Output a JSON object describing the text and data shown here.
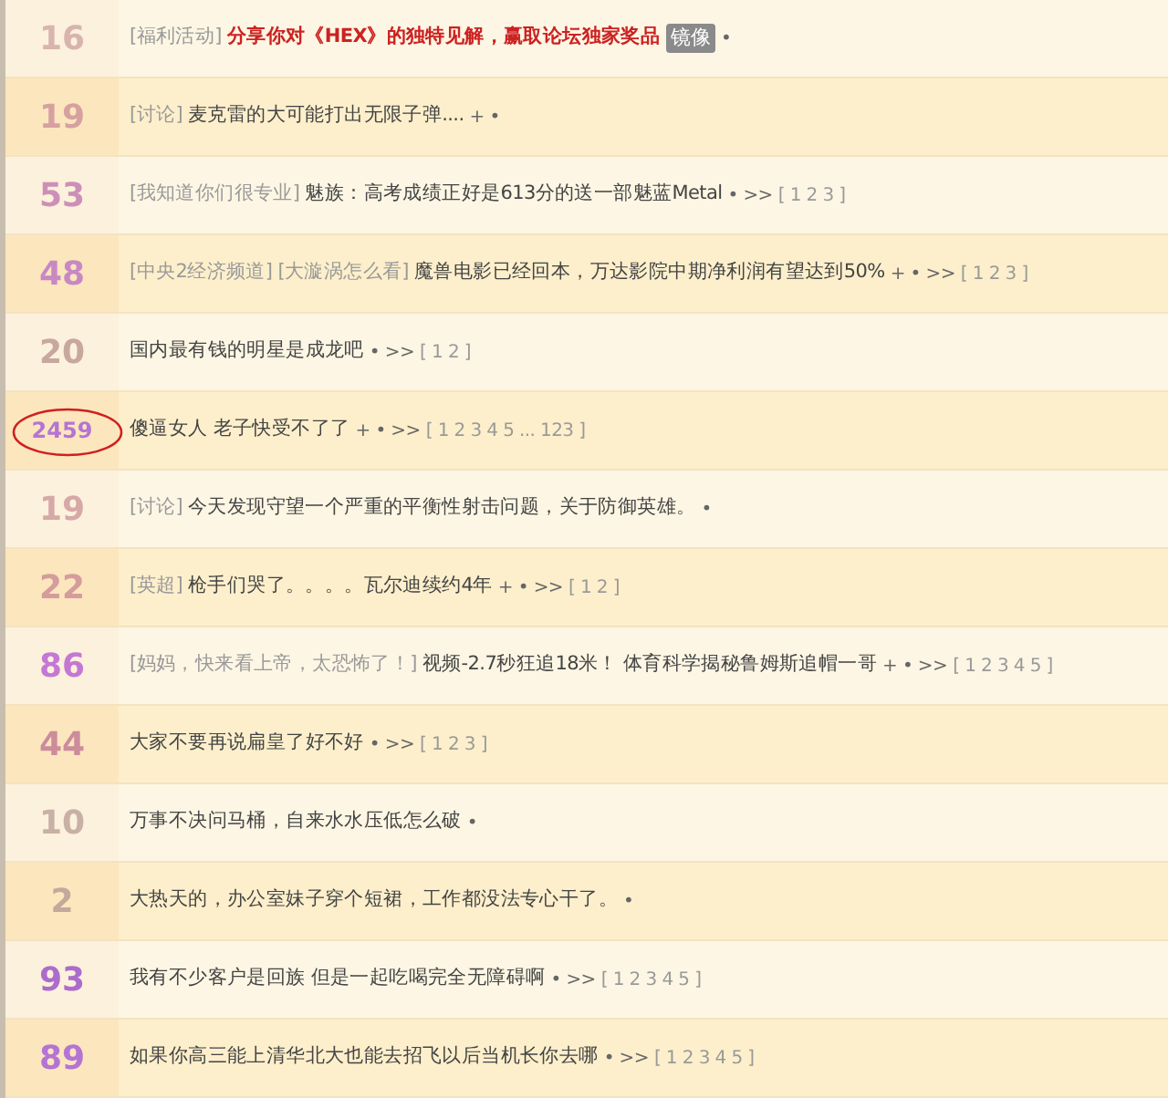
{
  "topics": [
    {
      "count": "16",
      "color": "#d8b4ae",
      "alt": false,
      "tags": [
        "[福利活动]"
      ],
      "title": "分享你对《HEX》的独特见解，赢取论坛独家奖品",
      "highlight": true,
      "badge": "镜像",
      "marks": "•"
    },
    {
      "count": "19",
      "color": "#d6a0a0",
      "alt": true,
      "tags": [
        "[讨论]"
      ],
      "title": "麦克雷的大可能打出无限子弹....",
      "highlight": false,
      "marks": "+ •"
    },
    {
      "count": "53",
      "color": "#cc90b8",
      "alt": false,
      "tags": [
        "[我知道你们很专业]"
      ],
      "title": "魅族：高考成绩正好是613分的送一部魅蓝Metal",
      "highlight": false,
      "marks": "• >>",
      "pages": "[ 1 2 3 ]"
    },
    {
      "count": "48",
      "color": "#c888c4",
      "alt": true,
      "tags": [
        "[中央2经济频道]",
        "[大漩涡怎么看]"
      ],
      "title": "魔兽电影已经回本，万达影院中期净利润有望达到50%",
      "highlight": false,
      "marks": "+ • >>",
      "pages": "[ 1 2 3 ]"
    },
    {
      "count": "20",
      "color": "#c8a89e",
      "alt": false,
      "title": "国内最有钱的明星是成龙吧",
      "highlight": false,
      "marks": "• >>",
      "pages": "[ 1 2 ]"
    },
    {
      "count": "2459",
      "color": "#b474d4",
      "alt": true,
      "circled": true,
      "title": "傻逼女人 老子快受不了了",
      "highlight": false,
      "marks": "+ • >>",
      "pages": "[ 1 2 3 4 5 ... 123 ]"
    },
    {
      "count": "19",
      "color": "#d6a8a8",
      "alt": false,
      "tags": [
        "[讨论]"
      ],
      "title": "今天发现守望一个严重的平衡性射击问题，关于防御英雄。",
      "highlight": false,
      "marks": "•"
    },
    {
      "count": "22",
      "color": "#d49c9c",
      "alt": true,
      "tags": [
        "[英超]"
      ],
      "title": "枪手们哭了。。。。瓦尔迪续约4年",
      "highlight": false,
      "marks": "+ • >>",
      "pages": "[ 1 2 ]"
    },
    {
      "count": "86",
      "color": "#c478d4",
      "alt": false,
      "tags": [
        "[妈妈，快来看上帝，太恐怖了！]"
      ],
      "title": "视频-2.7秒狂追18米！ 体育科学揭秘鲁姆斯追帽一哥",
      "highlight": false,
      "marks": "+ • >>",
      "pages": "[ 1 2 3 4 5 ]"
    },
    {
      "count": "44",
      "color": "#cc8c9c",
      "alt": true,
      "title": "大家不要再说扁皇了好不好",
      "highlight": false,
      "marks": "• >>",
      "pages": "[ 1 2 3 ]"
    },
    {
      "count": "10",
      "color": "#c8b0a6",
      "alt": false,
      "title": "万事不决问马桶，自来水水压低怎么破",
      "highlight": false,
      "marks": "•"
    },
    {
      "count": "2",
      "color": "#c4a89c",
      "alt": true,
      "title": "大热天的，办公室妹子穿个短裙，工作都没法专心干了。",
      "highlight": false,
      "marks": "•"
    },
    {
      "count": "93",
      "color": "#ac6ccc",
      "alt": false,
      "title": "我有不少客户是回族 但是一起吃喝完全无障碍啊",
      "highlight": false,
      "marks": "• >>",
      "pages": "[ 1 2 3 4 5 ]"
    },
    {
      "count": "89",
      "color": "#b474d4",
      "alt": true,
      "title": "如果你高三能上清华北大也能去招飞以后当机长你去哪",
      "highlight": false,
      "marks": "• >>",
      "pages": "[ 1 2 3 4 5 ]"
    }
  ]
}
